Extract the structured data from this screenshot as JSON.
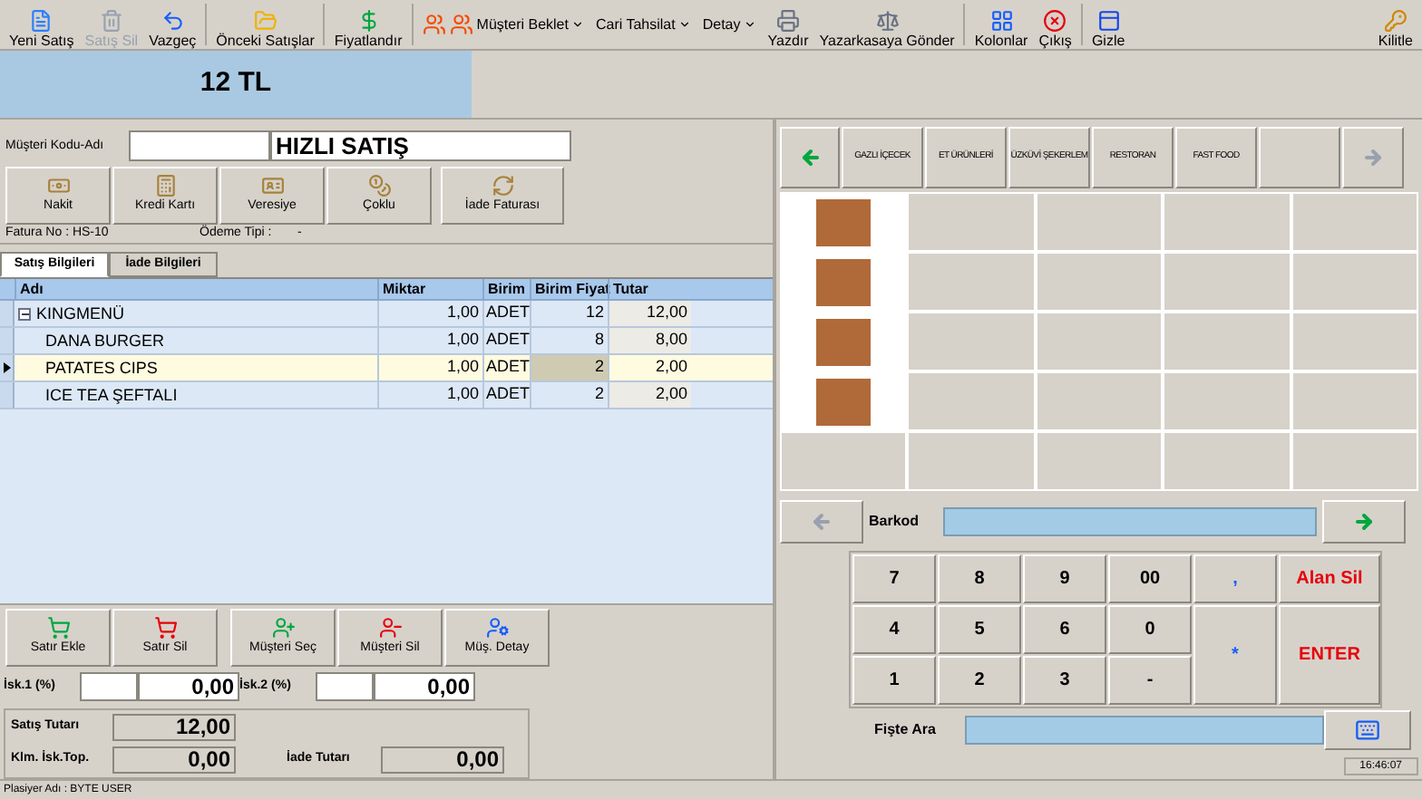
{
  "toolbar": {
    "items": [
      {
        "label": "Yeni Satış",
        "kind": "button",
        "disabled": false
      },
      {
        "label": "Satış Sil",
        "kind": "button",
        "disabled": true
      },
      {
        "label": "Vazgeç",
        "kind": "button",
        "disabled": false
      },
      {
        "label": "Önceki Satışlar",
        "kind": "button",
        "disabled": false
      },
      {
        "label": "Fiyatlandır",
        "kind": "button",
        "disabled": false
      },
      {
        "label": "Müşteri Beklet",
        "kind": "dropdown",
        "disabled": false
      },
      {
        "label": "Cari Tahsilat",
        "kind": "dropdown",
        "disabled": false
      },
      {
        "label": "Detay",
        "kind": "dropdown",
        "disabled": false
      },
      {
        "label": "Yazdır",
        "kind": "button",
        "disabled": false
      },
      {
        "label": "Yazarkasaya Gönder",
        "kind": "button",
        "disabled": false
      },
      {
        "label": "Kolonlar",
        "kind": "button",
        "disabled": false
      },
      {
        "label": "Çıkış",
        "kind": "button",
        "disabled": false
      },
      {
        "label": "Gizle",
        "kind": "button",
        "disabled": false
      }
    ],
    "right_item": {
      "label": "Kilitle"
    }
  },
  "total_display": "12 TL",
  "customer": {
    "label": "Müşteri Kodu-Adı",
    "name": "HIZLI SATIŞ"
  },
  "payment_buttons": [
    "Nakit",
    "Kredi Kartı",
    "Veresiye",
    "Çoklu",
    "İade Faturası"
  ],
  "invoice_no": "Fatura No : HS-10",
  "payment_type_label": "Ödeme Tipi :",
  "payment_type": "-",
  "tabs": [
    {
      "label": "Satış Bilgileri",
      "selected": true
    },
    {
      "label": "İade Bilgileri",
      "selected": false
    }
  ],
  "table": {
    "columns": [
      "Adı",
      "Miktar",
      "Birim",
      "Birim Fiyat",
      "Tutar"
    ],
    "rows": [
      {
        "name": "KINGMENÜ",
        "expanded": true,
        "selected": false,
        "qty": "1,00",
        "unit": "ADET",
        "price": "12",
        "total": "12,00",
        "children": [
          {
            "name": "DANA BURGER",
            "selected": false,
            "qty": "1,00",
            "unit": "ADET",
            "price": "8",
            "total": "8,00"
          },
          {
            "name": "PATATES CIPS",
            "selected": true,
            "qty": "1,00",
            "unit": "ADET",
            "price": "2",
            "total": "2,00"
          },
          {
            "name": "ICE TEA ŞEFTALI",
            "selected": false,
            "qty": "1,00",
            "unit": "ADET",
            "price": "2",
            "total": "2,00"
          }
        ]
      }
    ]
  },
  "row_buttons": [
    "Satır Ekle",
    "Satır Sil",
    "Müşteri Seç",
    "Müşteri Sil",
    "Müş. Detay"
  ],
  "discounts": [
    {
      "label": "İsk.1 (%)",
      "value": "0,00"
    },
    {
      "label": "İsk.2 (%)",
      "value": "0,00"
    }
  ],
  "totals": {
    "sale_label": "Satış Tutarı",
    "sale": "12,00",
    "discount_label": "Klm. İsk.Top.",
    "discount": "0,00",
    "return_label": "İade Tutarı",
    "return": "0,00"
  },
  "categories": [
    "GAZLI İÇECEK",
    "ET ÜRÜNLERİ",
    "ÜZKÜVİ ŞEKERLEM",
    "RESTORAN",
    "FAST FOOD"
  ],
  "product_tiles": [
    {
      "kind": "photo"
    },
    {
      "kind": "empty"
    },
    {
      "kind": "empty"
    },
    {
      "kind": "empty"
    },
    {
      "kind": "empty"
    },
    {
      "kind": "photo"
    },
    {
      "kind": "empty"
    },
    {
      "kind": "empty"
    },
    {
      "kind": "empty"
    },
    {
      "kind": "empty"
    },
    {
      "kind": "photo"
    },
    {
      "kind": "empty"
    },
    {
      "kind": "empty"
    },
    {
      "kind": "empty"
    },
    {
      "kind": "empty"
    },
    {
      "kind": "photo"
    },
    {
      "kind": "empty"
    },
    {
      "kind": "empty"
    },
    {
      "kind": "empty"
    },
    {
      "kind": "empty"
    },
    {
      "kind": "empty"
    },
    {
      "kind": "empty"
    },
    {
      "kind": "empty"
    },
    {
      "kind": "empty"
    },
    {
      "kind": "empty"
    }
  ],
  "barcode_label": "Barkod",
  "keypad": {
    "digits": [
      "7",
      "8",
      "9",
      "00",
      "4",
      "5",
      "6",
      "0",
      "1",
      "2",
      "3",
      "-"
    ],
    "symbols": [
      ",",
      "*"
    ],
    "actions": [
      "Alan Sil",
      "ENTER"
    ]
  },
  "receipt_search_label": "Fişte Ara",
  "cashier": "Plasiyer Adı : BYTE USER",
  "time": "16:46:07"
}
